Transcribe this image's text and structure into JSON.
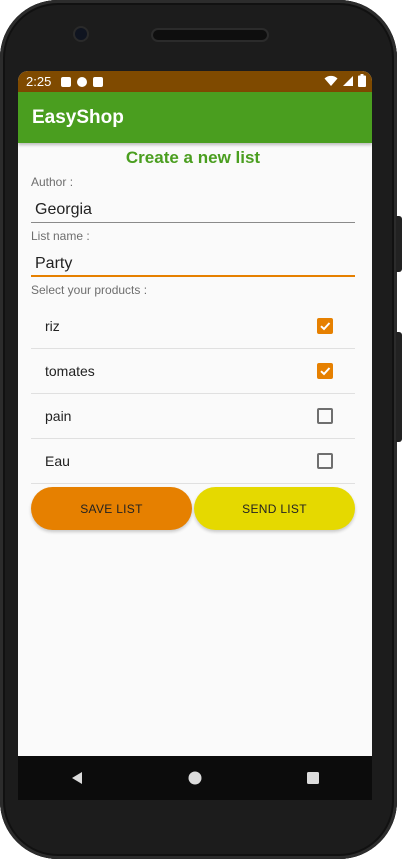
{
  "statusbar": {
    "time": "2:25",
    "colors": {
      "background": "#7f4a00"
    }
  },
  "app": {
    "title": "EasyShop",
    "accent_color": "#4a9e1f"
  },
  "form": {
    "page_title": "Create a new list",
    "author_label": "Author :",
    "author_value": "Georgia",
    "list_name_label": "List name :",
    "list_name_value": "Party",
    "products_label": "Select your products :"
  },
  "products": [
    {
      "name": "riz",
      "checked": true
    },
    {
      "name": "tomates",
      "checked": true
    },
    {
      "name": "pain",
      "checked": false
    },
    {
      "name": "Eau",
      "checked": false
    }
  ],
  "buttons": {
    "save_label": "SAVE LIST",
    "save_color": "#e68000",
    "send_label": "SEND LIST",
    "send_color": "#e5d900"
  },
  "navbar": {
    "icons": [
      "back-icon",
      "home-icon",
      "recents-icon"
    ]
  }
}
